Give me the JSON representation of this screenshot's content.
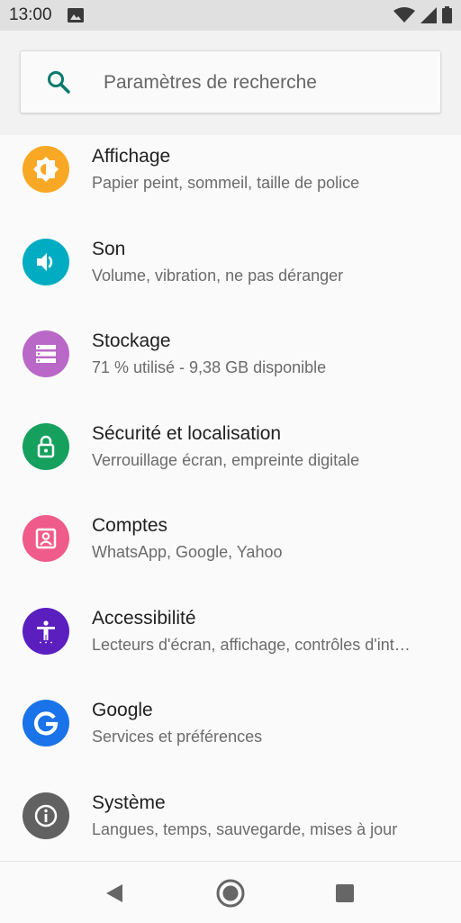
{
  "status_bar": {
    "time": "13:00",
    "icons": [
      "image-icon",
      "wifi-icon",
      "signal-icon",
      "battery-icon"
    ]
  },
  "search": {
    "placeholder": "Paramètres de recherche",
    "icon": "search-icon",
    "accent": "#00796b"
  },
  "settings": [
    {
      "title": "Affichage",
      "subtitle": "Papier peint, sommeil, taille de police",
      "icon": "display-icon",
      "color": "#f9a825"
    },
    {
      "title": "Son",
      "subtitle": "Volume, vibration, ne pas déranger",
      "icon": "volume-icon",
      "color": "#00acc1"
    },
    {
      "title": "Stockage",
      "subtitle": "71 % utilisé - 9,38 GB disponible",
      "icon": "storage-icon",
      "color": "#ba68c8"
    },
    {
      "title": "Sécurité et localisation",
      "subtitle": "Verrouillage écran, empreinte digitale",
      "icon": "lock-icon",
      "color": "#16a05d"
    },
    {
      "title": "Comptes",
      "subtitle": "WhatsApp, Google, Yahoo",
      "icon": "account-icon",
      "color": "#ef5b8a"
    },
    {
      "title": "Accessibilité",
      "subtitle": "Lecteurs d'écran, affichage, contrôles d'int…",
      "icon": "accessibility-icon",
      "color": "#5b1fc0"
    },
    {
      "title": "Google",
      "subtitle": "Services et préférences",
      "icon": "google-icon",
      "color": "#1a73e8"
    },
    {
      "title": "Système",
      "subtitle": "Langues, temps, sauvegarde, mises à jour",
      "icon": "info-icon",
      "color": "#616161"
    }
  ],
  "nav_bar": {
    "buttons": [
      "back-icon",
      "home-icon",
      "recents-icon"
    ]
  }
}
